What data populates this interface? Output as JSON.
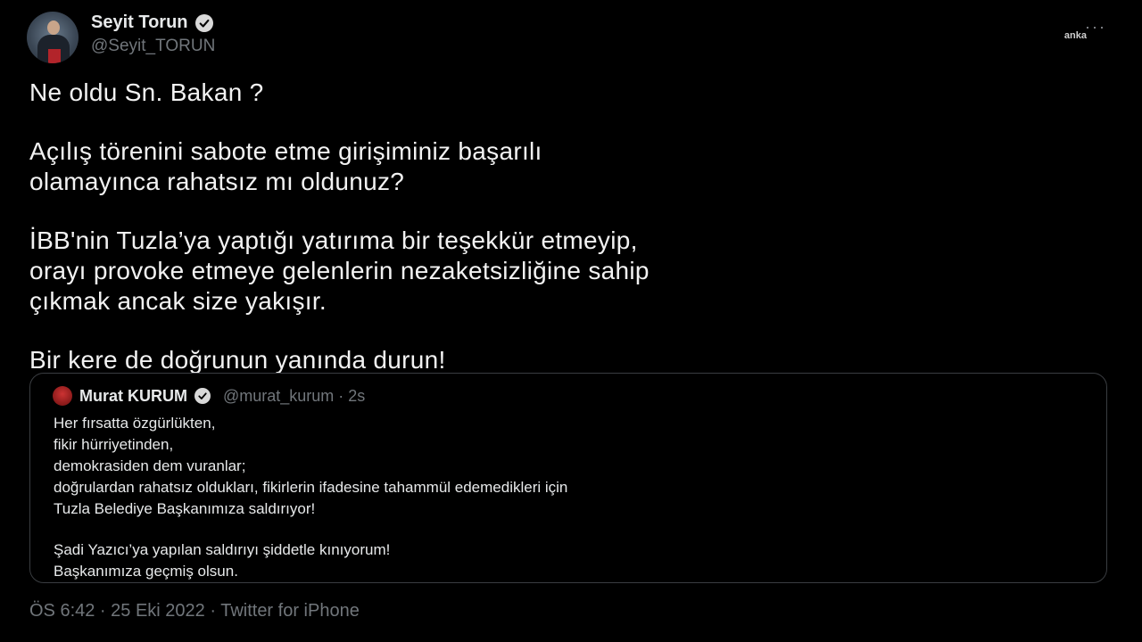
{
  "author": {
    "display_name": "Seyit Torun",
    "handle": "@Seyit_TORUN"
  },
  "more_icon": "···",
  "watermark": "anka",
  "tweet": {
    "paragraphs": [
      [
        "Ne oldu Sn. Bakan ?"
      ],
      [
        "Açılış törenini sabote etme girişiminiz başarılı",
        "olamayınca rahatsız mı oldunuz?"
      ],
      [
        "İBB'nin Tuzla’ya yaptığı yatırıma bir teşekkür etmeyip,",
        "orayı provoke etmeye gelenlerin nezaketsizliğine sahip",
        "çıkmak ancak size yakışır."
      ],
      [
        "Bir kere de doğrunun yanında durun!"
      ]
    ]
  },
  "quote": {
    "display_name": "Murat KURUM",
    "meta": "@murat_kurum · 2s",
    "lines": [
      "Her fırsatta özgürlükten,",
      "fikir hürriyetinden,",
      "demokrasiden dem vuranlar;",
      "doğrulardan rahatsız oldukları, fikirlerin ifadesine tahammül edemedikleri için",
      "Tuzla Belediye Başkanımıza saldırıyor!",
      "",
      "Şadi Yazıcı’ya yapılan saldırıyı şiddetle kınıyorum!",
      "Başkanımıza geçmiş olsun."
    ]
  },
  "footer": "ÖS 6:42 · 25 Eki 2022 · Twitter for iPhone"
}
